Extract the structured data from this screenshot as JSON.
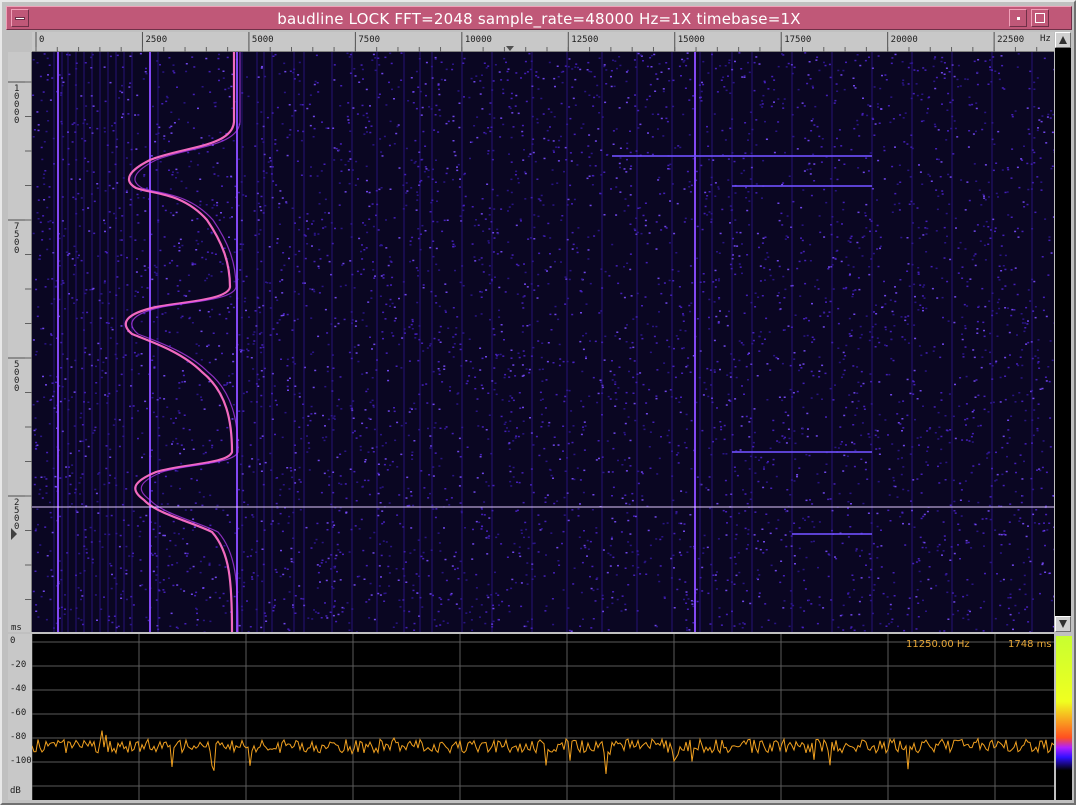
{
  "window": {
    "title": "baudline  LOCK FFT=2048 sample_rate=48000 Hz=1X timebase=1X"
  },
  "freq_axis": {
    "unit": "Hz",
    "ticks": [
      "0",
      "2500",
      "5000",
      "7500",
      "10000",
      "12500",
      "15000",
      "17500",
      "20000",
      "22500"
    ]
  },
  "time_axis": {
    "unit": "ms",
    "ticks": [
      "10000",
      "7500",
      "5000",
      "2500"
    ]
  },
  "db_axis": {
    "unit": "dB",
    "ticks": [
      "0",
      "-20",
      "-40",
      "-60",
      "-80",
      "-100"
    ]
  },
  "readout": {
    "frequency": "11250.00 Hz",
    "time": "1748 ms"
  },
  "colors": {
    "titlebar": "#c05878",
    "spectrogram_bg": "#0a0622",
    "noise": "#5a2ae0",
    "trace": "#ff70c8",
    "spectrum_line": "#f0a020",
    "readout": "#e8a838"
  }
}
